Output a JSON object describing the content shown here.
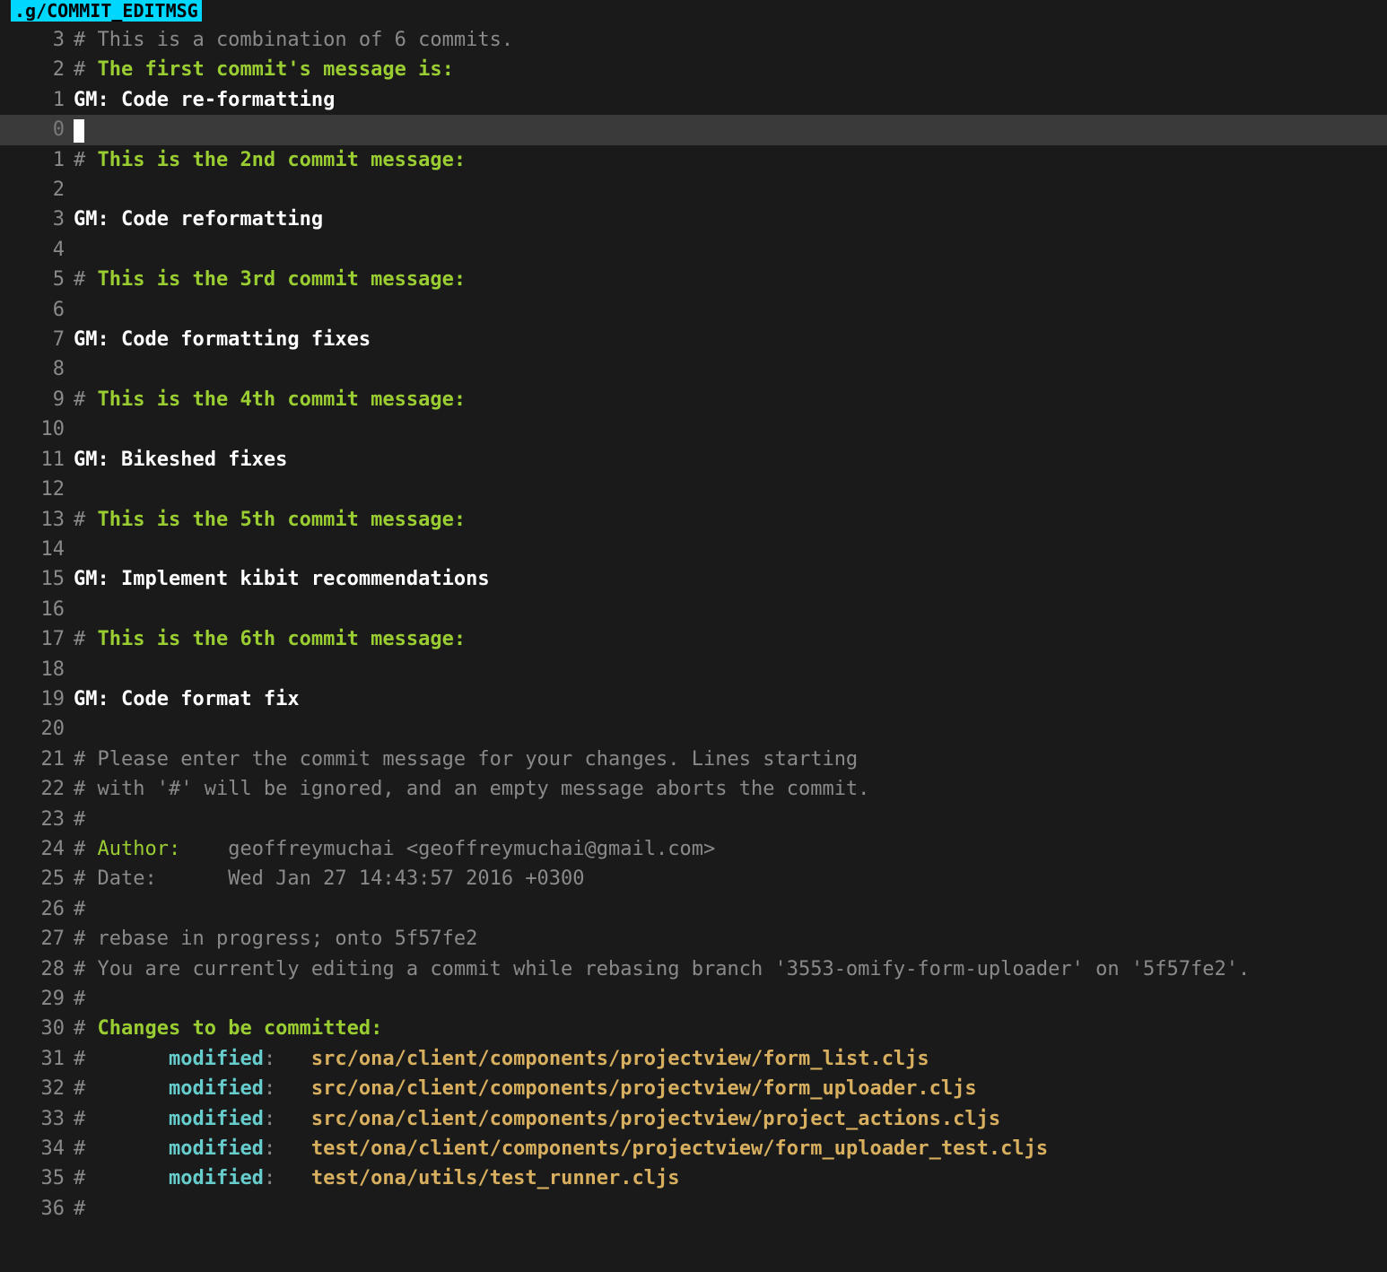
{
  "tab": {
    "title": ".g/COMMIT_EDITMSG"
  },
  "rows": [
    {
      "ln": "3",
      "cls": "",
      "num_cls": "c-grey",
      "spans": [
        {
          "cls": "c-grey",
          "txt": "# This is a combination of 6 commits."
        }
      ]
    },
    {
      "ln": "2",
      "cls": "",
      "num_cls": "c-grey",
      "spans": [
        {
          "cls": "c-grey",
          "txt": "# "
        },
        {
          "cls": "c-green",
          "txt": "The first commit's message is:"
        }
      ]
    },
    {
      "ln": "1",
      "cls": "",
      "num_cls": "c-grey",
      "spans": [
        {
          "cls": "c-white",
          "txt": "GM: Code re-formatting"
        }
      ]
    },
    {
      "ln": "0",
      "cls": "cursor-row",
      "num_cls": "c-grey",
      "cursor": true,
      "spans": []
    },
    {
      "ln": "1",
      "cls": "",
      "num_cls": "c-grey",
      "spans": [
        {
          "cls": "c-grey",
          "txt": "# "
        },
        {
          "cls": "c-green",
          "txt": "This is the 2nd commit message:"
        }
      ]
    },
    {
      "ln": "2",
      "cls": "",
      "num_cls": "c-grey",
      "spans": []
    },
    {
      "ln": "3",
      "cls": "",
      "num_cls": "c-grey",
      "spans": [
        {
          "cls": "c-white",
          "txt": "GM: Code reformatting"
        }
      ]
    },
    {
      "ln": "4",
      "cls": "",
      "num_cls": "c-grey",
      "spans": []
    },
    {
      "ln": "5",
      "cls": "",
      "num_cls": "c-grey",
      "spans": [
        {
          "cls": "c-grey",
          "txt": "# "
        },
        {
          "cls": "c-green",
          "txt": "This is the 3rd commit message:"
        }
      ]
    },
    {
      "ln": "6",
      "cls": "",
      "num_cls": "c-grey",
      "spans": []
    },
    {
      "ln": "7",
      "cls": "",
      "num_cls": "c-grey",
      "spans": [
        {
          "cls": "c-white",
          "txt": "GM: Code formatting fixes"
        }
      ]
    },
    {
      "ln": "8",
      "cls": "",
      "num_cls": "c-grey",
      "spans": []
    },
    {
      "ln": "9",
      "cls": "",
      "num_cls": "c-grey",
      "spans": [
        {
          "cls": "c-grey",
          "txt": "# "
        },
        {
          "cls": "c-green",
          "txt": "This is the 4th commit message:"
        }
      ]
    },
    {
      "ln": "10",
      "cls": "",
      "num_cls": "c-grey",
      "spans": []
    },
    {
      "ln": "11",
      "cls": "",
      "num_cls": "c-grey",
      "spans": [
        {
          "cls": "c-white",
          "txt": "GM: Bikeshed fixes"
        }
      ]
    },
    {
      "ln": "12",
      "cls": "",
      "num_cls": "c-grey",
      "spans": []
    },
    {
      "ln": "13",
      "cls": "",
      "num_cls": "c-grey",
      "spans": [
        {
          "cls": "c-grey",
          "txt": "# "
        },
        {
          "cls": "c-green",
          "txt": "This is the 5th commit message:"
        }
      ]
    },
    {
      "ln": "14",
      "cls": "",
      "num_cls": "c-grey",
      "spans": []
    },
    {
      "ln": "15",
      "cls": "",
      "num_cls": "c-grey",
      "spans": [
        {
          "cls": "c-white",
          "txt": "GM: Implement kibit recommendations"
        }
      ]
    },
    {
      "ln": "16",
      "cls": "",
      "num_cls": "c-grey",
      "spans": []
    },
    {
      "ln": "17",
      "cls": "",
      "num_cls": "c-grey",
      "spans": [
        {
          "cls": "c-grey",
          "txt": "# "
        },
        {
          "cls": "c-green",
          "txt": "This is the 6th commit message:"
        }
      ]
    },
    {
      "ln": "18",
      "cls": "",
      "num_cls": "c-grey",
      "spans": []
    },
    {
      "ln": "19",
      "cls": "",
      "num_cls": "c-grey",
      "spans": [
        {
          "cls": "c-white",
          "txt": "GM: Code format fix"
        }
      ]
    },
    {
      "ln": "20",
      "cls": "",
      "num_cls": "c-grey",
      "spans": []
    },
    {
      "ln": "21",
      "cls": "",
      "num_cls": "c-grey",
      "spans": [
        {
          "cls": "c-grey",
          "txt": "# Please enter the commit message for your changes. Lines starting"
        }
      ]
    },
    {
      "ln": "22",
      "cls": "",
      "num_cls": "c-grey",
      "spans": [
        {
          "cls": "c-grey",
          "txt": "# with '#' will be ignored, and an empty message aborts the commit."
        }
      ]
    },
    {
      "ln": "23",
      "cls": "",
      "num_cls": "c-grey",
      "spans": [
        {
          "cls": "c-grey",
          "txt": "#"
        }
      ]
    },
    {
      "ln": "24",
      "cls": "",
      "num_cls": "c-grey",
      "spans": [
        {
          "cls": "c-grey",
          "txt": "# "
        },
        {
          "cls": "c-green-n",
          "txt": "Author:"
        },
        {
          "cls": "c-grey",
          "txt": "    geoffreymuchai <geoffreymuchai@gmail.com>"
        }
      ]
    },
    {
      "ln": "25",
      "cls": "",
      "num_cls": "c-grey",
      "spans": [
        {
          "cls": "c-grey",
          "txt": "# Date:      Wed Jan 27 14:43:57 2016 +0300"
        }
      ]
    },
    {
      "ln": "26",
      "cls": "",
      "num_cls": "c-grey",
      "spans": [
        {
          "cls": "c-grey",
          "txt": "#"
        }
      ]
    },
    {
      "ln": "27",
      "cls": "",
      "num_cls": "c-grey",
      "spans": [
        {
          "cls": "c-grey",
          "txt": "# rebase in progress; onto 5f57fe2"
        }
      ]
    },
    {
      "ln": "28",
      "cls": "",
      "num_cls": "c-grey",
      "spans": [
        {
          "cls": "c-grey",
          "txt": "# You are currently editing a commit while rebasing branch '3553-omify-form-uploader' on '5f57fe2'."
        }
      ]
    },
    {
      "ln": "29",
      "cls": "",
      "num_cls": "c-grey",
      "spans": [
        {
          "cls": "c-grey",
          "txt": "#"
        }
      ]
    },
    {
      "ln": "30",
      "cls": "",
      "num_cls": "c-grey",
      "spans": [
        {
          "cls": "c-grey",
          "txt": "# "
        },
        {
          "cls": "c-green",
          "txt": "Changes to be committed:"
        }
      ]
    },
    {
      "ln": "31",
      "cls": "",
      "num_cls": "c-grey",
      "spans": [
        {
          "cls": "c-grey",
          "txt": "#       "
        },
        {
          "cls": "c-cyan",
          "txt": "modified"
        },
        {
          "cls": "c-grey",
          "txt": ":   "
        },
        {
          "cls": "c-yellow",
          "txt": "src/ona/client/components/projectview/form_list.cljs"
        }
      ]
    },
    {
      "ln": "32",
      "cls": "",
      "num_cls": "c-grey",
      "spans": [
        {
          "cls": "c-grey",
          "txt": "#       "
        },
        {
          "cls": "c-cyan",
          "txt": "modified"
        },
        {
          "cls": "c-grey",
          "txt": ":   "
        },
        {
          "cls": "c-yellow",
          "txt": "src/ona/client/components/projectview/form_uploader.cljs"
        }
      ]
    },
    {
      "ln": "33",
      "cls": "",
      "num_cls": "c-grey",
      "spans": [
        {
          "cls": "c-grey",
          "txt": "#       "
        },
        {
          "cls": "c-cyan",
          "txt": "modified"
        },
        {
          "cls": "c-grey",
          "txt": ":   "
        },
        {
          "cls": "c-yellow",
          "txt": "src/ona/client/components/projectview/project_actions.cljs"
        }
      ]
    },
    {
      "ln": "34",
      "cls": "",
      "num_cls": "c-grey",
      "spans": [
        {
          "cls": "c-grey",
          "txt": "#       "
        },
        {
          "cls": "c-cyan",
          "txt": "modified"
        },
        {
          "cls": "c-grey",
          "txt": ":   "
        },
        {
          "cls": "c-yellow",
          "txt": "test/ona/client/components/projectview/form_uploader_test.cljs"
        }
      ]
    },
    {
      "ln": "35",
      "cls": "",
      "num_cls": "c-grey",
      "spans": [
        {
          "cls": "c-grey",
          "txt": "#       "
        },
        {
          "cls": "c-cyan",
          "txt": "modified"
        },
        {
          "cls": "c-grey",
          "txt": ":   "
        },
        {
          "cls": "c-yellow",
          "txt": "test/ona/utils/test_runner.cljs"
        }
      ]
    },
    {
      "ln": "36",
      "cls": "",
      "num_cls": "c-grey",
      "spans": [
        {
          "cls": "c-grey",
          "txt": "#"
        }
      ]
    }
  ]
}
